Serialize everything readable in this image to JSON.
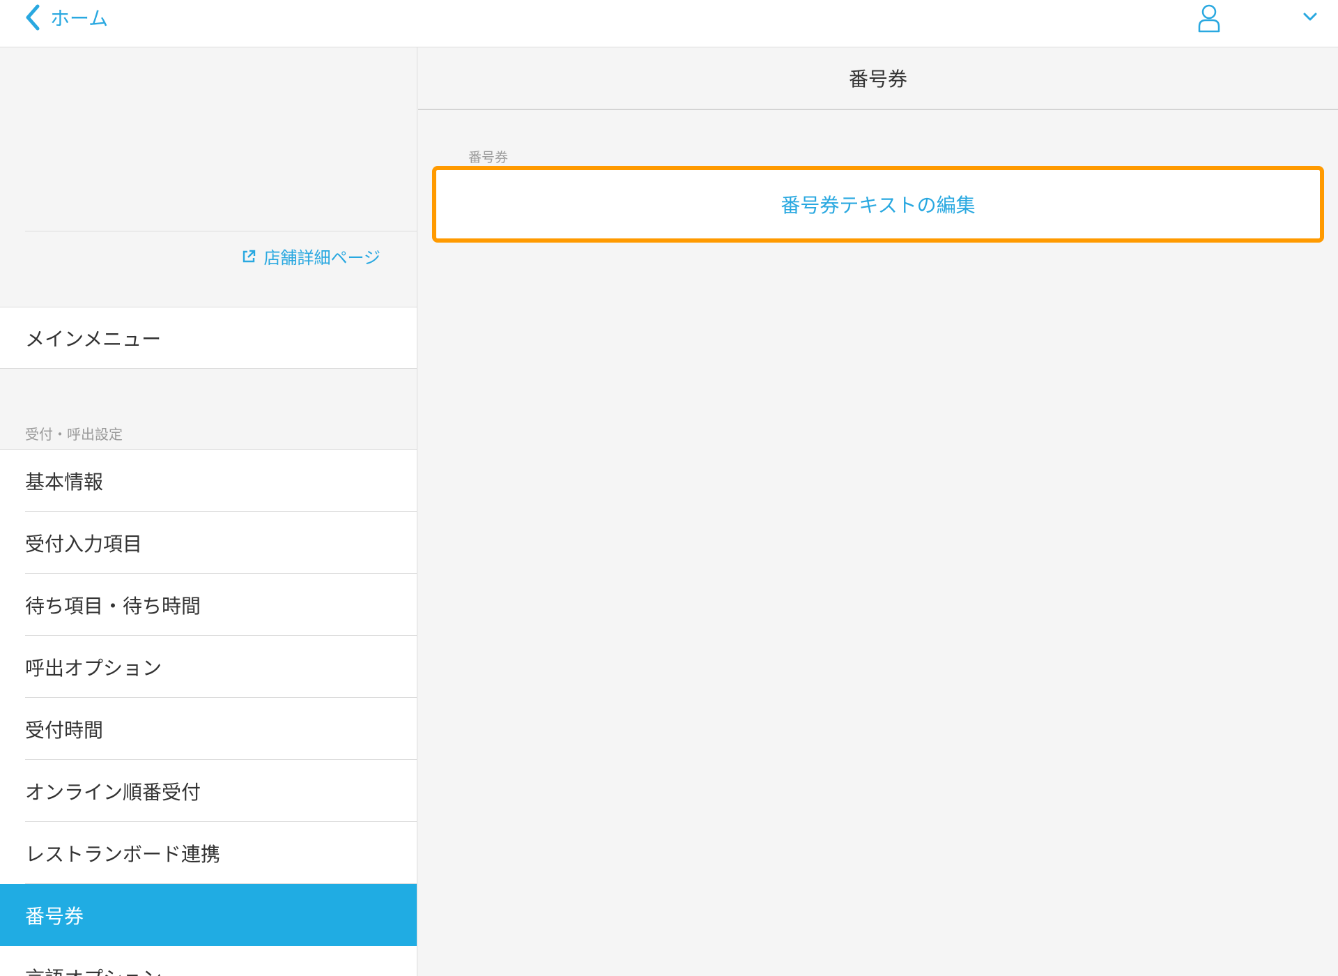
{
  "colors": {
    "accent": "#29a8e0",
    "active_bg": "#20ace3",
    "highlight_outline": "#ff9a00",
    "background": "#f5f5f5"
  },
  "topbar": {
    "back_label": "ホーム",
    "back_icon": "chevron-left-icon",
    "user_icon": "user-icon",
    "menu_icon": "chevron-down-icon"
  },
  "sidebar": {
    "shop_link": "店舗詳細ページ",
    "shop_link_icon": "external-link-icon",
    "main_menu": "メインメニュー",
    "section_header": "受付・呼出設定",
    "items": [
      {
        "label": "基本情報",
        "active": false
      },
      {
        "label": "受付入力項目",
        "active": false
      },
      {
        "label": "待ち項目・待ち時間",
        "active": false
      },
      {
        "label": "呼出オプション",
        "active": false
      },
      {
        "label": "受付時間",
        "active": false
      },
      {
        "label": "オンライン順番受付",
        "active": false
      },
      {
        "label": "レストランボード連携",
        "active": false
      },
      {
        "label": "番号券",
        "active": true
      },
      {
        "label": "言語オプション",
        "active": false
      }
    ]
  },
  "main": {
    "title": "番号券",
    "group_label": "番号券",
    "edit_button": "番号券テキストの編集"
  }
}
